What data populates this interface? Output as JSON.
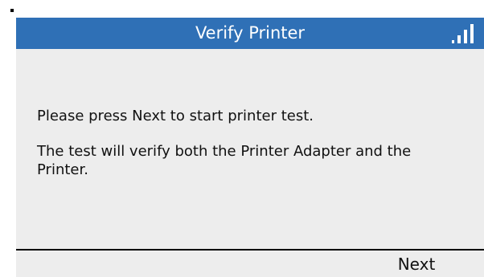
{
  "header": {
    "title": "Verify Printer",
    "signal_icon": "signal-strength-icon",
    "bar_color": "#2f70b6"
  },
  "message": {
    "line1": "Please press Next to start printer test.",
    "line2": "The test will verify both the Printer Adapter and the Printer."
  },
  "footer": {
    "next_label": "Next"
  }
}
